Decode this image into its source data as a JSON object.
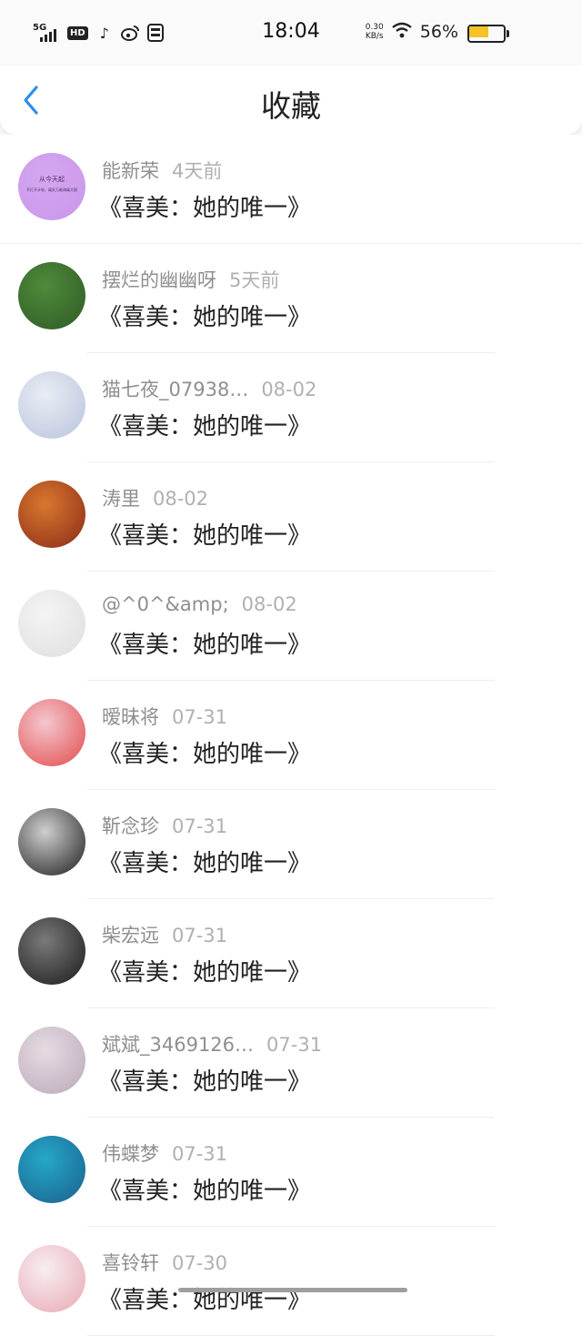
{
  "status_bar": {
    "network": "5G",
    "hd": "HD",
    "time": "18:04",
    "speed_value": "0.30",
    "speed_unit": "KB/s",
    "battery_pct": "56%",
    "battery_level": 0.56,
    "battery_color": "#f6c225"
  },
  "nav": {
    "title": "收藏",
    "back_icon": "chevron-left-icon",
    "accent": "#2b8fe8"
  },
  "items": [
    {
      "user": "能新荣",
      "time": "4天前",
      "title": "《喜美：她的唯一》",
      "avatar_text": "从今天起",
      "avatar_sub": "不打开计较，痛失万能疏痛大厨",
      "avatar_colors": [
        "#d4a6f0",
        "#c997ea"
      ]
    },
    {
      "user": "摆烂的幽幽呀",
      "time": "5天前",
      "title": "《喜美：她的唯一》",
      "avatar_colors": [
        "#4f8b3a",
        "#2e5a26"
      ]
    },
    {
      "user": "猫七夜_07938…",
      "time": "08-02",
      "title": "《喜美：她的唯一》",
      "avatar_colors": [
        "#e9ecf3",
        "#b8c4dd"
      ]
    },
    {
      "user": "涛里",
      "time": "08-02",
      "title": "《喜美：她的唯一》",
      "avatar_colors": [
        "#d8782f",
        "#8a2a18"
      ]
    },
    {
      "user": "@^0^&amp;",
      "time": "08-02",
      "title": "《喜美：她的唯一》",
      "avatar_colors": [
        "#f4f4f4",
        "#dedede"
      ]
    },
    {
      "user": "暧昧将",
      "time": "07-31",
      "title": "《喜美：她的唯一》",
      "avatar_colors": [
        "#f3c7cf",
        "#e24b4b"
      ]
    },
    {
      "user": "靳念珍",
      "time": "07-31",
      "title": "《喜美：她的唯一》",
      "avatar_colors": [
        "#cfcfcf",
        "#1d1d1d"
      ]
    },
    {
      "user": "柴宏远",
      "time": "07-31",
      "title": "《喜美：她的唯一》",
      "avatar_colors": [
        "#7a7a7a",
        "#1a1a1a"
      ]
    },
    {
      "user": "斌斌_3469126…",
      "time": "07-31",
      "title": "《喜美：她的唯一》",
      "avatar_colors": [
        "#e6dbe3",
        "#b9a9b8"
      ]
    },
    {
      "user": "伟蝶梦",
      "time": "07-31",
      "title": "《喜美：她的唯一》",
      "avatar_colors": [
        "#25a8c6",
        "#1b5f8f"
      ]
    },
    {
      "user": "喜铃轩",
      "time": "07-30",
      "title": "《喜美：她的唯一》",
      "avatar_colors": [
        "#f7eef0",
        "#e9a7b3"
      ]
    }
  ]
}
